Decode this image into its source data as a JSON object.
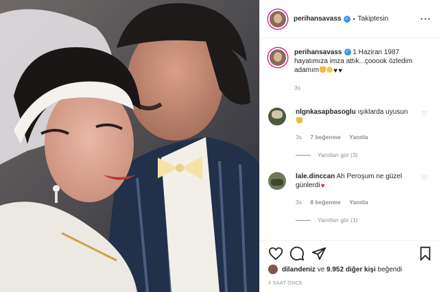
{
  "post": {
    "username": "perihansavass",
    "follow_status": "Takiptesin",
    "caption_date": "1 Haziran 1987",
    "caption_text": "hayatımıza imza attık...çooook özledim adamım",
    "caption_time": "3s"
  },
  "comments": [
    {
      "username": "nlgnkasapbasoglu",
      "text": "ışıklarda uyusun",
      "time": "3s",
      "likes": "7 beğenme",
      "reply": "Yanıtla",
      "view_replies": "Yanıtları gör (3)"
    },
    {
      "username": "lale.dinccan",
      "text": "Ah Peroşum ne güzel günlerdi",
      "time": "3s",
      "likes": "8 beğenme",
      "reply": "Yanıtla",
      "view_replies": "Yanıtları gör (1)"
    }
  ],
  "likes_line": {
    "user": "dilandeniz",
    "connector": "ve",
    "count": "9.952 diğer kişi",
    "suffix": "beğendi"
  },
  "posted_ago": "3 SAAT ÖNCE",
  "icons": {
    "verified": "verified-badge-icon",
    "more": "more-options-icon",
    "like": "heart-icon",
    "comment": "comment-bubble-icon",
    "share": "send-paper-plane-icon",
    "save": "bookmark-icon"
  },
  "colors": {
    "verified_blue": "#3897f0",
    "text": "#262626",
    "muted": "#8e8e8e",
    "story_ring": "#d6249f"
  }
}
